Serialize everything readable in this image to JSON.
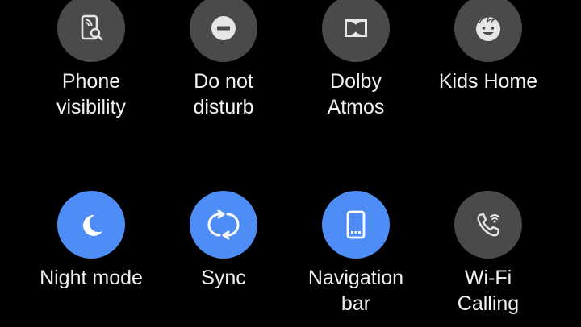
{
  "quick_settings": {
    "tiles": [
      {
        "label": "Phone\nvisibility",
        "icon": "phone-visibility-icon",
        "state": "off"
      },
      {
        "label": "Do not\ndisturb",
        "icon": "do-not-disturb-icon",
        "state": "off"
      },
      {
        "label": "Dolby\nAtmos",
        "icon": "dolby-icon",
        "state": "off"
      },
      {
        "label": "Kids Home",
        "icon": "kids-face-icon",
        "state": "off"
      },
      {
        "label": "Night mode",
        "icon": "moon-icon",
        "state": "on"
      },
      {
        "label": "Sync",
        "icon": "sync-icon",
        "state": "on"
      },
      {
        "label": "Navigation\nbar",
        "icon": "navigation-bar-icon",
        "state": "on"
      },
      {
        "label": "Wi-Fi\nCalling",
        "icon": "wifi-calling-icon",
        "state": "off"
      }
    ]
  },
  "colors": {
    "background": "#000000",
    "tile_off": "#4a4a4a",
    "tile_on": "#4d8df5",
    "icon_off": "#e6e6e6",
    "icon_on": "#ffffff",
    "label": "#f2f2f2"
  }
}
